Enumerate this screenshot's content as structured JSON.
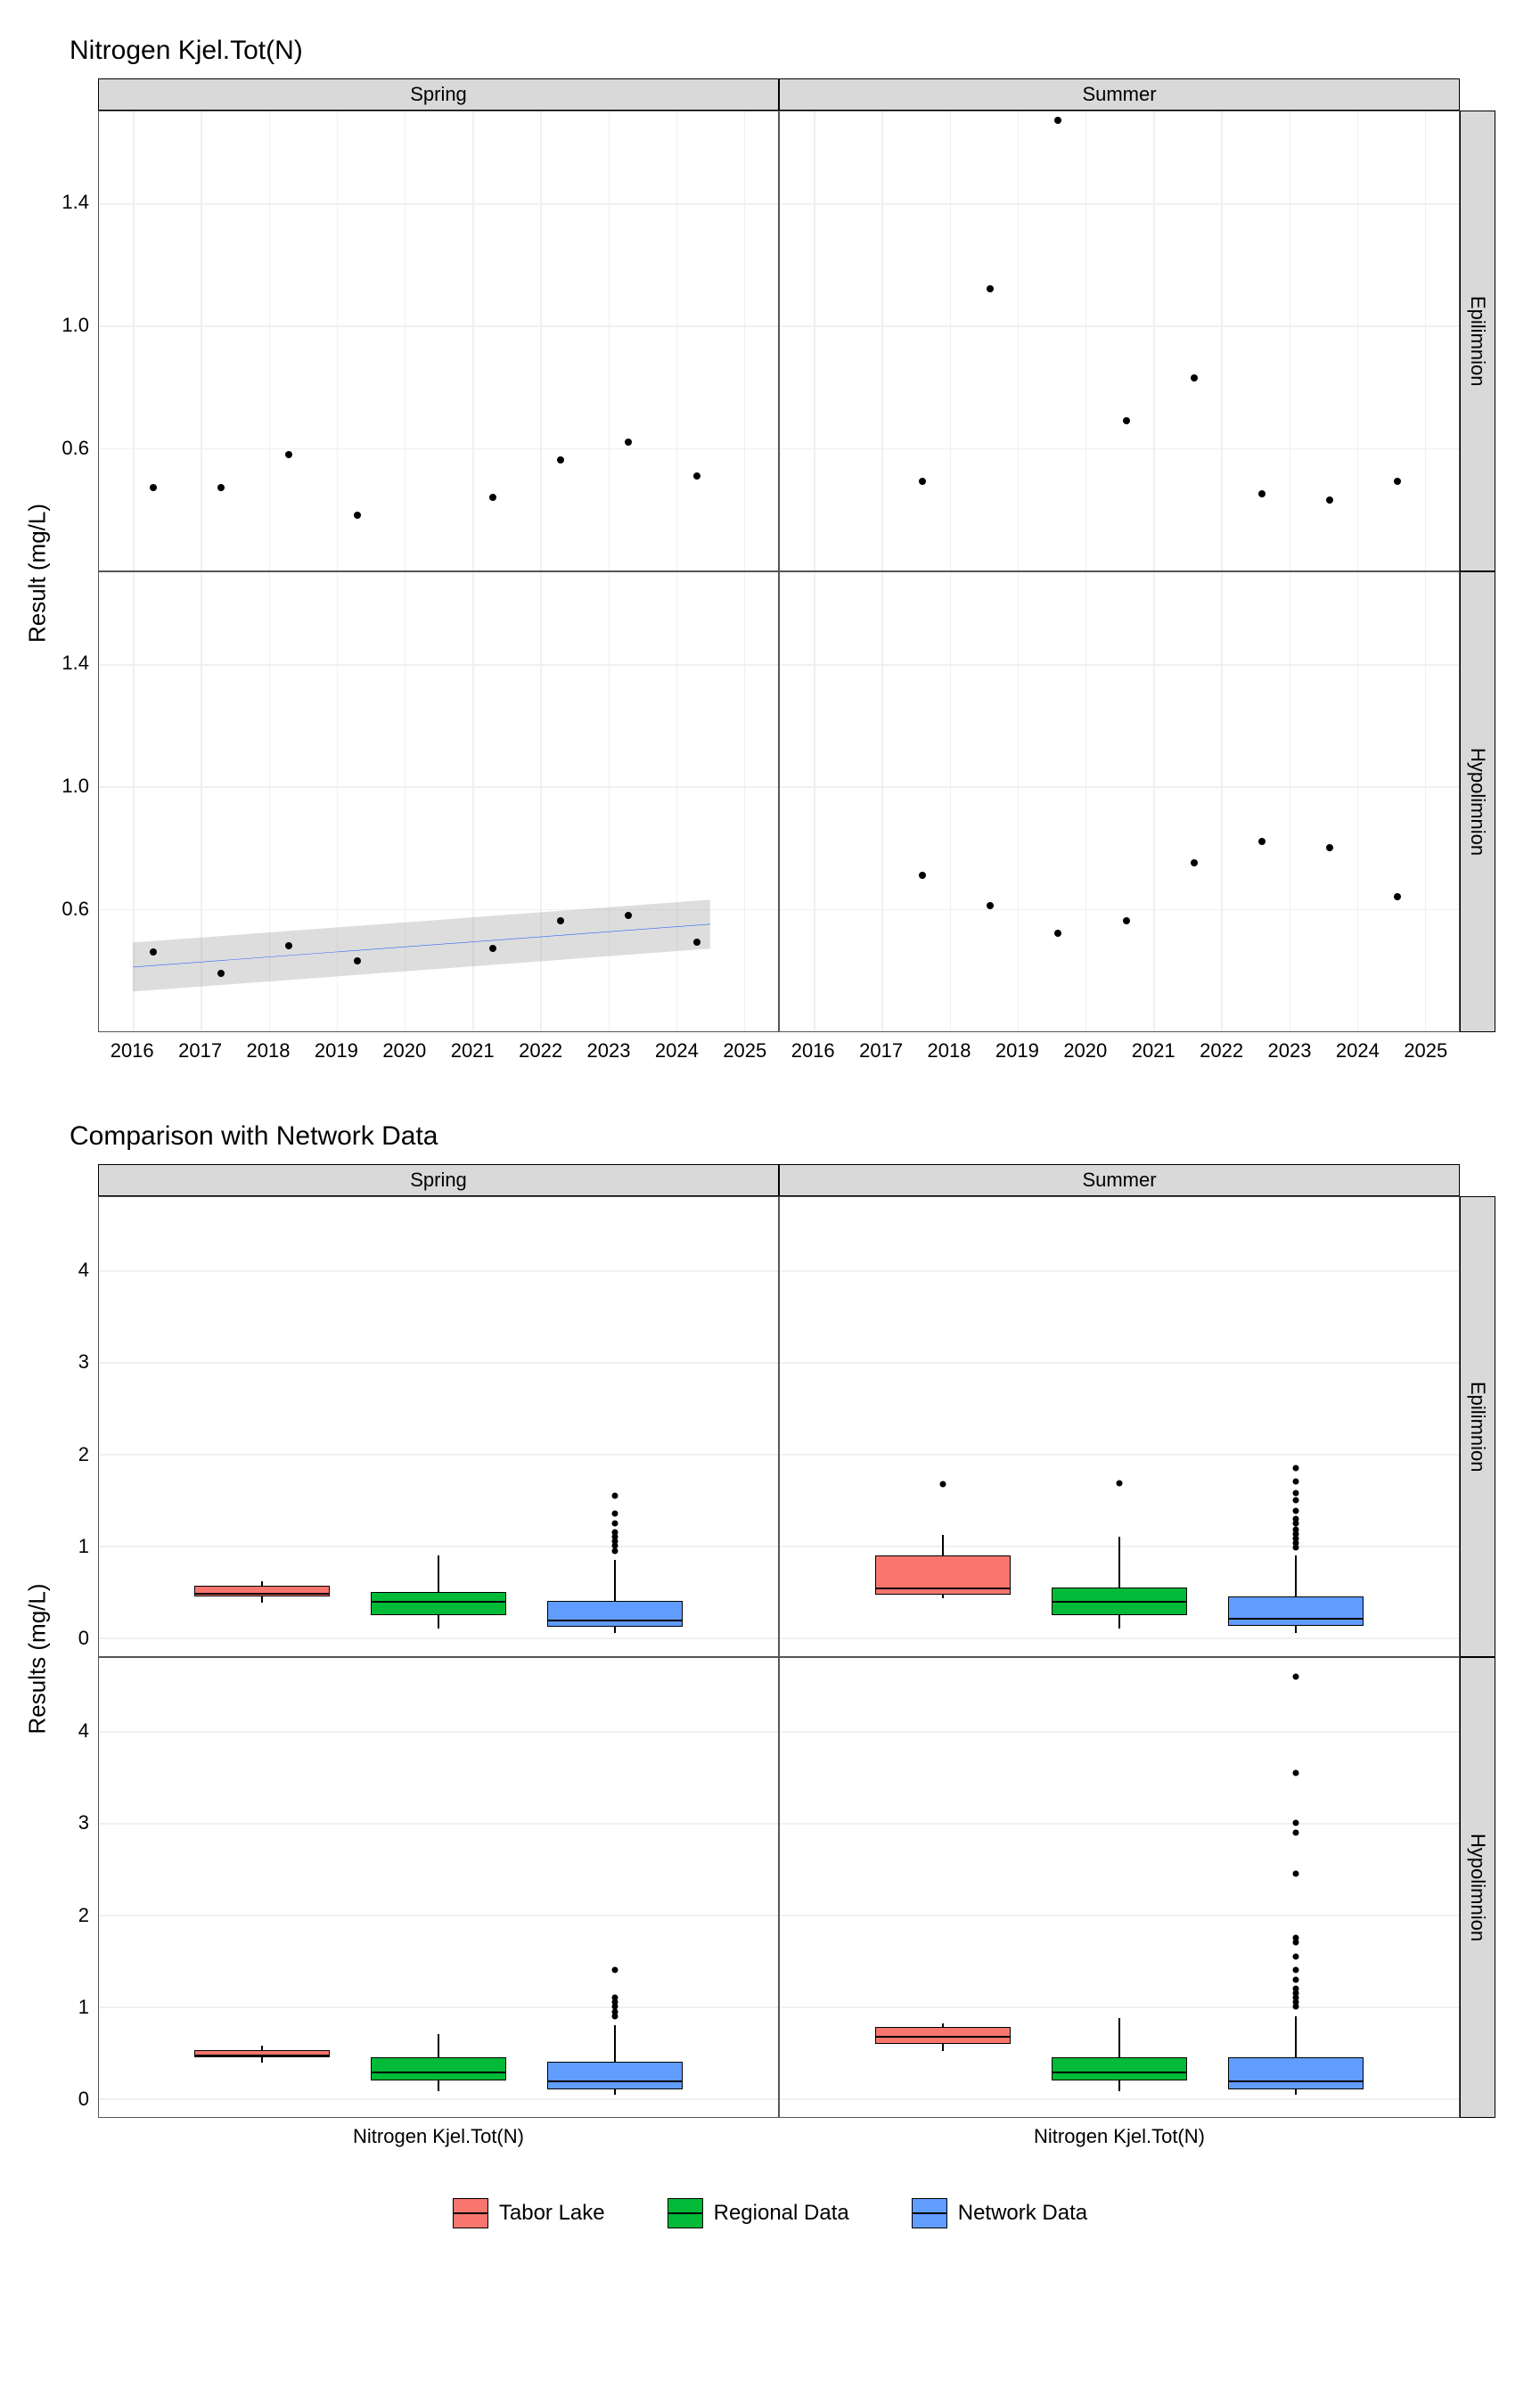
{
  "chart_data": [
    {
      "title": "Nitrogen Kjel.Tot(N)",
      "type": "scatter",
      "ylabel": "Result (mg/L)",
      "xlabel": "",
      "facets": {
        "cols": [
          "Spring",
          "Summer"
        ],
        "rows": [
          "Epilimnion",
          "Hypolimnion"
        ]
      },
      "x_range": [
        2015.5,
        2025.5
      ],
      "y_range": [
        0.2,
        1.7
      ],
      "y_ticks": [
        0.6,
        1.0,
        1.4
      ],
      "x_ticks": [
        2016,
        2017,
        2018,
        2019,
        2020,
        2021,
        2022,
        2023,
        2024,
        2025
      ],
      "panels": {
        "Spring_Epilimnion": {
          "points": [
            [
              2016.3,
              0.47
            ],
            [
              2017.3,
              0.47
            ],
            [
              2018.3,
              0.58
            ],
            [
              2019.3,
              0.38
            ],
            [
              2021.3,
              0.44
            ],
            [
              2022.3,
              0.56
            ],
            [
              2023.3,
              0.62
            ],
            [
              2024.3,
              0.51
            ]
          ]
        },
        "Summer_Epilimnion": {
          "points": [
            [
              2017.6,
              0.49
            ],
            [
              2018.6,
              1.12
            ],
            [
              2019.6,
              1.67
            ],
            [
              2020.6,
              0.69
            ],
            [
              2021.6,
              0.83
            ],
            [
              2022.6,
              0.45
            ],
            [
              2023.6,
              0.43
            ],
            [
              2024.6,
              0.49
            ]
          ]
        },
        "Spring_Hypolimnion": {
          "points": [
            [
              2016.3,
              0.46
            ],
            [
              2017.3,
              0.39
            ],
            [
              2018.3,
              0.48
            ],
            [
              2019.3,
              0.43
            ],
            [
              2021.3,
              0.47
            ],
            [
              2022.3,
              0.56
            ],
            [
              2023.3,
              0.58
            ],
            [
              2024.3,
              0.49
            ]
          ],
          "trend": {
            "x": [
              2016.0,
              2024.5
            ],
            "y": [
              0.41,
              0.55
            ],
            "ribbon_lo": [
              0.33,
              0.47
            ],
            "ribbon_hi": [
              0.49,
              0.63
            ]
          }
        },
        "Summer_Hypolimnion": {
          "points": [
            [
              2017.6,
              0.71
            ],
            [
              2018.6,
              0.61
            ],
            [
              2019.6,
              0.52
            ],
            [
              2020.6,
              0.56
            ],
            [
              2021.6,
              0.75
            ],
            [
              2022.6,
              0.82
            ],
            [
              2023.6,
              0.8
            ],
            [
              2024.6,
              0.64
            ]
          ]
        }
      }
    },
    {
      "title": "Comparison with Network Data",
      "type": "boxplot",
      "ylabel": "Results (mg/L)",
      "xlabel": "Nitrogen Kjel.Tot(N)",
      "facets": {
        "cols": [
          "Spring",
          "Summer"
        ],
        "rows": [
          "Epilimnion",
          "Hypolimnion"
        ]
      },
      "y_range": [
        -0.2,
        4.8
      ],
      "y_ticks": [
        0,
        1,
        2,
        3,
        4
      ],
      "series_colors": {
        "Tabor Lake": "#f8766d",
        "Regional Data": "#00ba38",
        "Network Data": "#619cff"
      },
      "series_order": [
        "Tabor Lake",
        "Regional Data",
        "Network Data"
      ],
      "panels": {
        "Spring_Epilimnion": {
          "Tabor Lake": {
            "min": 0.38,
            "q1": 0.45,
            "med": 0.49,
            "q3": 0.57,
            "max": 0.62
          },
          "Regional Data": {
            "min": 0.1,
            "q1": 0.25,
            "med": 0.4,
            "q3": 0.5,
            "max": 0.9
          },
          "Network Data": {
            "min": 0.05,
            "q1": 0.12,
            "med": 0.2,
            "q3": 0.4,
            "max": 0.85,
            "outliers": [
              0.95,
              1.0,
              1.05,
              1.1,
              1.15,
              1.25,
              1.35,
              1.55
            ]
          }
        },
        "Summer_Epilimnion": {
          "Tabor Lake": {
            "min": 0.43,
            "q1": 0.47,
            "med": 0.55,
            "q3": 0.9,
            "max": 1.12,
            "outliers": [
              1.67
            ]
          },
          "Regional Data": {
            "min": 0.1,
            "q1": 0.25,
            "med": 0.4,
            "q3": 0.55,
            "max": 1.1,
            "outliers": [
              1.68
            ]
          },
          "Network Data": {
            "min": 0.05,
            "q1": 0.13,
            "med": 0.22,
            "q3": 0.45,
            "max": 0.9,
            "outliers": [
              0.98,
              1.03,
              1.08,
              1.13,
              1.18,
              1.25,
              1.3,
              1.38,
              1.5,
              1.58,
              1.7,
              1.85
            ]
          }
        },
        "Spring_Hypolimnion": {
          "Tabor Lake": {
            "min": 0.39,
            "q1": 0.45,
            "med": 0.48,
            "q3": 0.53,
            "max": 0.58
          },
          "Regional Data": {
            "min": 0.08,
            "q1": 0.2,
            "med": 0.3,
            "q3": 0.45,
            "max": 0.7
          },
          "Network Data": {
            "min": 0.04,
            "q1": 0.1,
            "med": 0.2,
            "q3": 0.4,
            "max": 0.8,
            "outliers": [
              0.9,
              0.95,
              1.0,
              1.05,
              1.1,
              1.4
            ]
          }
        },
        "Summer_Hypolimnion": {
          "Tabor Lake": {
            "min": 0.52,
            "q1": 0.6,
            "med": 0.68,
            "q3": 0.78,
            "max": 0.82
          },
          "Regional Data": {
            "min": 0.08,
            "q1": 0.2,
            "med": 0.3,
            "q3": 0.45,
            "max": 0.88
          },
          "Network Data": {
            "min": 0.04,
            "q1": 0.1,
            "med": 0.2,
            "q3": 0.45,
            "max": 0.9,
            "outliers": [
              1.0,
              1.05,
              1.1,
              1.15,
              1.2,
              1.3,
              1.4,
              1.55,
              1.7,
              1.75,
              2.45,
              2.9,
              3.0,
              3.55,
              4.6
            ]
          }
        }
      }
    }
  ],
  "legend": {
    "items": [
      "Tabor Lake",
      "Regional Data",
      "Network Data"
    ]
  }
}
